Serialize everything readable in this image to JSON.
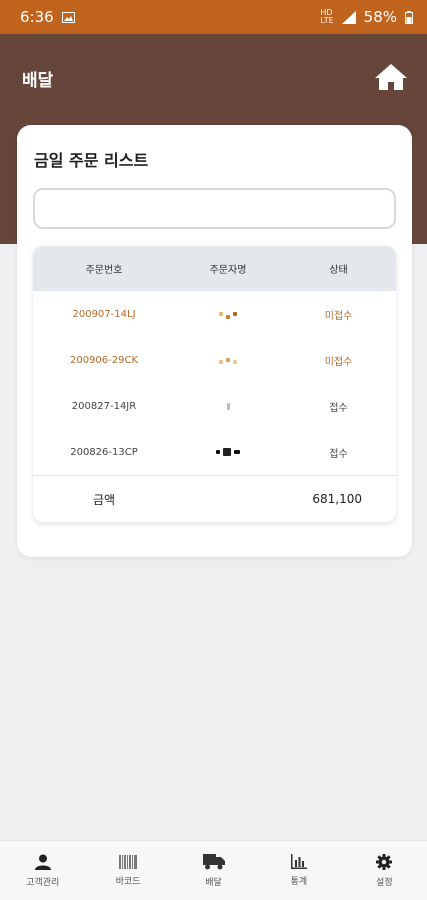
{
  "status_bar": {
    "time": "6:36",
    "net_top": "HD",
    "net_bottom": "LTE",
    "battery": "58%"
  },
  "header": {
    "title": "배달"
  },
  "card": {
    "title": "금일 주문 리스트",
    "search": {
      "value": "",
      "placeholder": ""
    },
    "table": {
      "columns": [
        "주문번호",
        "주문자명",
        "상태"
      ],
      "rows": [
        {
          "order_no": "200907-14LJ",
          "status": "미접수"
        },
        {
          "order_no": "200906-29CK",
          "status": "미접수"
        },
        {
          "order_no": "200827-14JR",
          "status": "접수"
        },
        {
          "order_no": "200826-13CP",
          "status": "접수"
        }
      ],
      "footer": {
        "label": "금액",
        "amount": "681,100"
      }
    }
  },
  "bottom_nav": [
    {
      "label": "고객관리",
      "icon": "person-icon"
    },
    {
      "label": "바코드",
      "icon": "barcode-icon"
    },
    {
      "label": "배달",
      "icon": "truck-icon"
    },
    {
      "label": "통계",
      "icon": "chart-icon"
    },
    {
      "label": "설정",
      "icon": "gear-icon"
    }
  ],
  "colors": {
    "status_bar": "#c0631c",
    "header": "#66463b",
    "pending_text": "#b56a2a"
  }
}
